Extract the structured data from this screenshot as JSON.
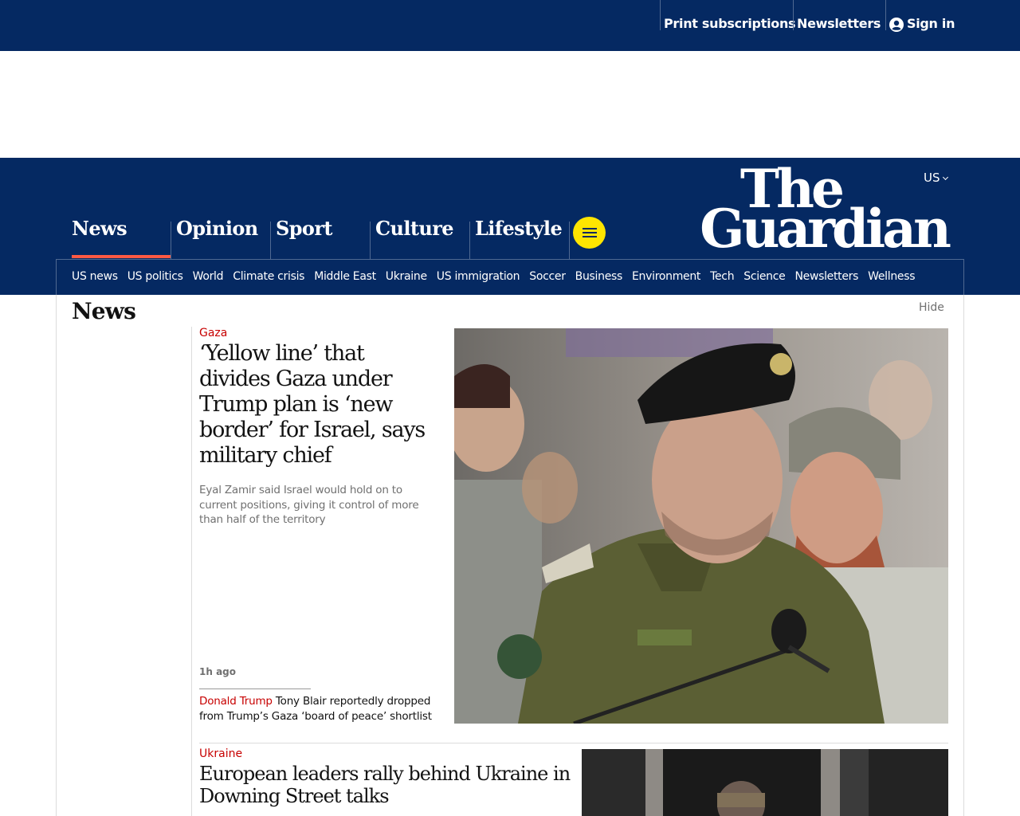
{
  "topbar": {
    "print_subscriptions": "Print subscriptions",
    "newsletters": "Newsletters",
    "sign_in": "Sign in"
  },
  "masthead": {
    "edition": "US",
    "logo_line1": "The",
    "logo_line2": "Guardian",
    "pillars": [
      "News",
      "Opinion",
      "Sport",
      "Culture",
      "Lifestyle"
    ],
    "subnav": [
      "US news",
      "US politics",
      "World",
      "Climate crisis",
      "Middle East",
      "Ukraine",
      "US immigration",
      "Soccer",
      "Business",
      "Environment",
      "Tech",
      "Science",
      "Newsletters",
      "Wellness"
    ]
  },
  "section": {
    "title": "News",
    "hide": "Hide"
  },
  "lead": {
    "kicker": "Gaza",
    "headline": "‘Yellow line’ that divides Gaza under Trump plan is ‘new border’ for Israel, says military chief",
    "standfirst": "Eyal Zamir said Israel would hold on to current positions, giving it control of more than half of the territory",
    "age": "1h ago",
    "sublink_kicker": "Donald Trump",
    "sublink_text": "Tony Blair reportedly dropped from Trump’s Gaza ‘board of peace’ shortlist"
  },
  "second": {
    "kicker": "Ukraine",
    "headline": "European leaders rally behind Ukraine in Downing Street talks"
  },
  "colors": {
    "brand_blue": "#052962",
    "news_red": "#c70000",
    "pillar_underline": "#ff5943",
    "menu_yellow": "#ffe500"
  }
}
